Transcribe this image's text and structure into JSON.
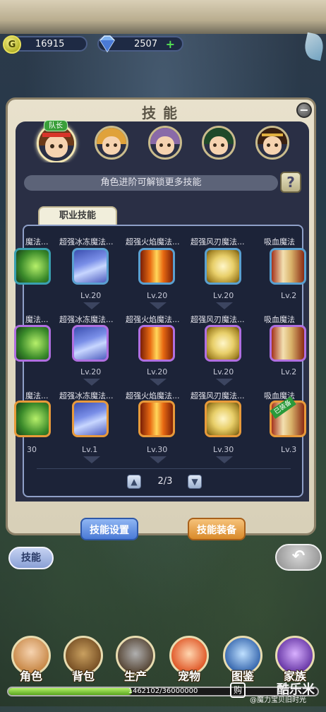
{
  "currency": {
    "gold": "16915",
    "gems": "2507",
    "gems_plus": "+"
  },
  "panel": {
    "title": "技能",
    "close": "−",
    "captain_badge": "队长",
    "hint": "角色进阶可解锁更多技能",
    "help": "?",
    "tab": "职业技能"
  },
  "skills": {
    "row1": {
      "names": [
        "魔法...",
        "超强冰冻魔法...",
        "超强火焰魔法...",
        "超强风刃魔法...",
        "吸血魔法"
      ],
      "levels": [
        "Lv.20",
        "Lv.20",
        "Lv.20",
        "Lv.2"
      ]
    },
    "row2": {
      "names": [
        "魔法...",
        "超强冰冻魔法...",
        "超强火焰魔法...",
        "超强风刃魔法...",
        "吸血魔法"
      ],
      "levels": [
        "Lv.20",
        "Lv.20",
        "Lv.20",
        "Lv.2"
      ]
    },
    "row3": {
      "names": [
        "魔法...",
        "超强冰冻魔法...",
        "超强火焰魔法...",
        "超强风刃魔法...",
        "吸血魔法"
      ],
      "levels": [
        "30",
        "Lv.1",
        "Lv.30",
        "Lv.30",
        "Lv.3"
      ]
    },
    "equipped_badge": "已装备"
  },
  "pager": {
    "text": "2/3",
    "up": "▲",
    "down": "▼"
  },
  "buttons": {
    "settings": "技能设置",
    "equip": "技能装备",
    "side": "技能",
    "back": "↶"
  },
  "nav": [
    "角色",
    "背包",
    "生产",
    "宠物",
    "图鉴",
    "家族"
  ],
  "xp": {
    "text": "1462102/36000000",
    "fraction": 0.4
  },
  "watermark": {
    "icon": "购",
    "big": "酷乐米",
    "small": "@魔力宝贝旧时光"
  },
  "colors": {
    "panel": "#e8e1cc",
    "dark": "#2a2f45",
    "accent_blue": "#4a7ad6",
    "accent_orange": "#d98a2a"
  }
}
